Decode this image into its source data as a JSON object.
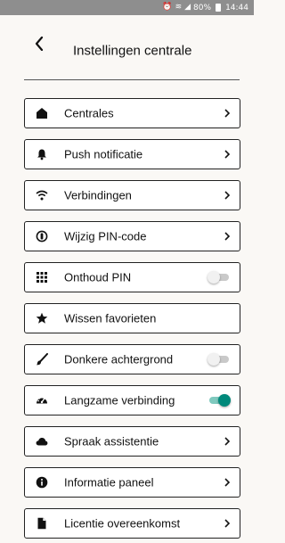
{
  "status_bar": {
    "battery": "80%",
    "time": "14:44",
    "icons": [
      "alarm-icon",
      "wifi-icon",
      "signal-icon",
      "battery-icon"
    ]
  },
  "header": {
    "title": "Instellingen centrale",
    "back_icon": "chevron-left-icon"
  },
  "colors": {
    "background": "#FAF8F5",
    "status_bar": "#8E8E8E",
    "toggle_on": "#00897B",
    "toggle_off": "#C9C9C9",
    "border": "#222222"
  },
  "menu": {
    "items": [
      {
        "label": "Centrales",
        "icon": "home-icon",
        "control": "chevron"
      },
      {
        "label": "Push notificatie",
        "icon": "bell-icon",
        "control": "chevron"
      },
      {
        "label": "Verbindingen",
        "icon": "wifi-icon",
        "control": "chevron"
      },
      {
        "label": "Wijzig PIN-code",
        "icon": "pin-code-icon",
        "control": "chevron"
      },
      {
        "label": "Onthoud PIN",
        "icon": "keypad-icon",
        "control": "toggle",
        "value": false
      },
      {
        "label": "Wissen favorieten",
        "icon": "star-icon",
        "control": "none"
      },
      {
        "label": "Donkere achtergrond",
        "icon": "paintbrush-icon",
        "control": "toggle",
        "value": false
      },
      {
        "label": "Langzame verbinding",
        "icon": "speedometer-icon",
        "control": "toggle",
        "value": true
      },
      {
        "label": "Spraak assistentie",
        "icon": "cloud-icon",
        "control": "chevron"
      },
      {
        "label": "Informatie paneel",
        "icon": "info-icon",
        "control": "chevron"
      },
      {
        "label": "Licentie overeenkomst",
        "icon": "document-icon",
        "control": "chevron"
      }
    ]
  }
}
